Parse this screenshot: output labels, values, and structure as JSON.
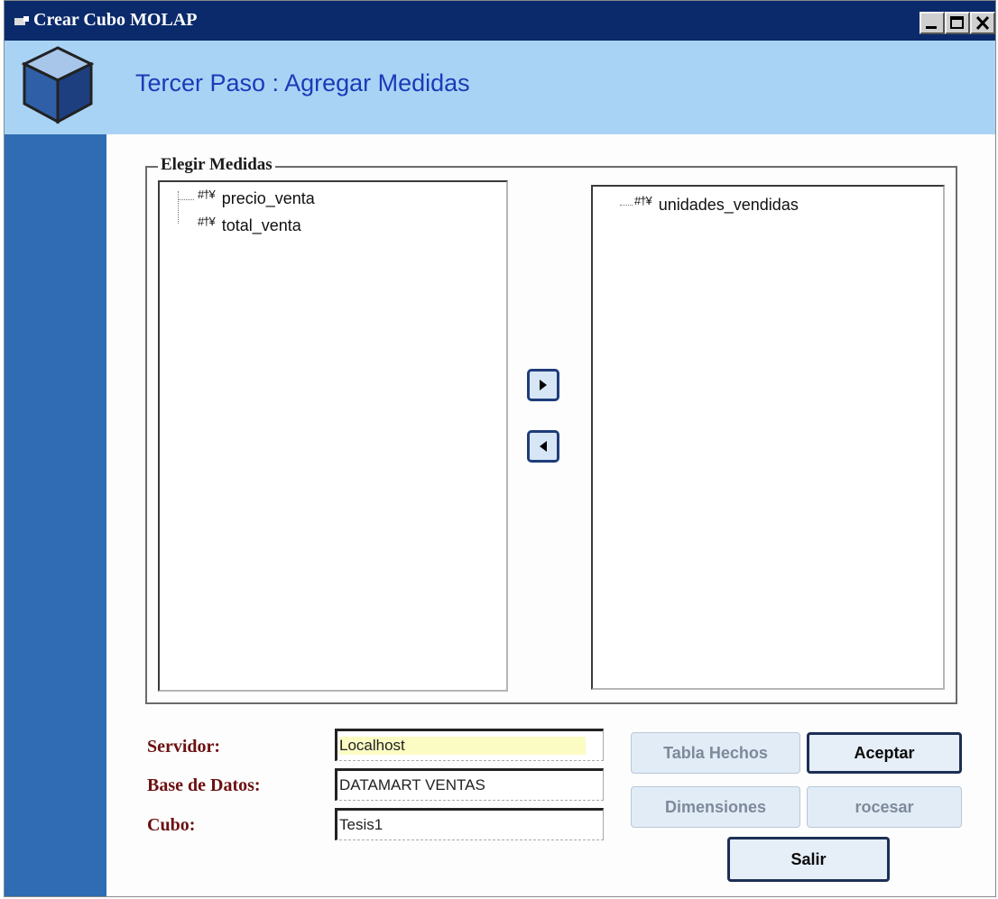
{
  "window": {
    "title": "Crear Cubo MOLAP"
  },
  "header": {
    "heading": "Tercer Paso : Agregar Medidas"
  },
  "group": {
    "label": "Elegir Medidas"
  },
  "left_list": {
    "items": [
      "precio_venta",
      "total_venta"
    ]
  },
  "right_list": {
    "items": [
      "unidades_vendidas"
    ]
  },
  "measure_icon_glyph": "#†¥",
  "form": {
    "servidor_label": "Servidor:",
    "servidor_value": "Localhost",
    "base_label": "Base de Datos:",
    "base_value": "DATAMART VENTAS",
    "cubo_label": "Cubo:",
    "cubo_value": "Tesis1"
  },
  "buttons": {
    "tabla_hechos": "Tabla Hechos",
    "aceptar": "Aceptar",
    "dimensiones": "Dimensiones",
    "procesar": "rocesar",
    "salir": "Salir"
  },
  "colors": {
    "titlebar": "#0a2a6b",
    "header_bg": "#a9d3f5",
    "sidebar": "#2f6cb3",
    "heading_text": "#1a3bb8",
    "label_text": "#6b1010"
  }
}
